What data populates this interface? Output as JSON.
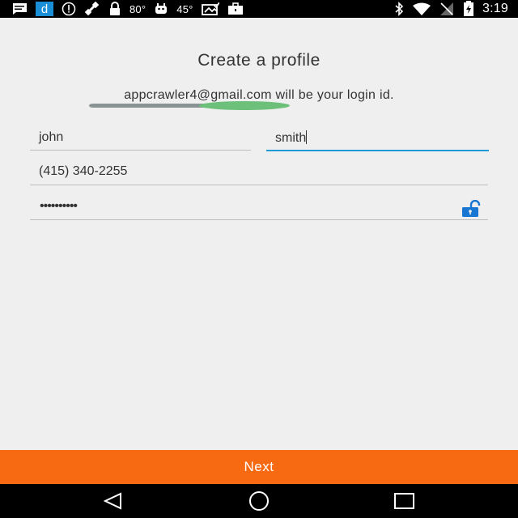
{
  "status_bar": {
    "temp_1": "80°",
    "temp_2": "45°",
    "time": "3:19"
  },
  "page": {
    "title": "Create a profile",
    "login_info": "appcrawler4@gmail.com will be your login id."
  },
  "form": {
    "first_name": "john",
    "last_name": "smith",
    "phone": "(415) 340-2255",
    "password_mask": "••••••••••"
  },
  "actions": {
    "next_label": "Next"
  },
  "icons": {
    "status_left": [
      "message-icon",
      "app-d-icon",
      "info-icon",
      "satellite-icon",
      "lock-icon",
      "android-icon",
      "photo-check-icon",
      "briefcase-icon"
    ],
    "status_right": [
      "bluetooth-icon",
      "wifi-icon",
      "no-signal-icon",
      "battery-charging-icon"
    ],
    "password_toggle": "unlock-icon",
    "nav": [
      "back-icon",
      "home-icon",
      "recents-icon"
    ]
  },
  "colors": {
    "accent_orange": "#f76a11",
    "focus_blue": "#1e9bd6",
    "lock_blue": "#1976d2"
  }
}
